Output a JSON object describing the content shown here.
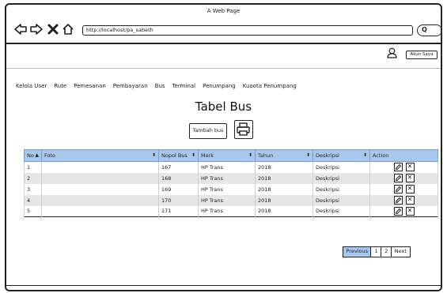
{
  "window": {
    "title": "A Web Page"
  },
  "browser": {
    "url": "http://localhost/pa_sabeth",
    "search_glyph": "Q"
  },
  "header": {
    "account_button": "Akun Saya"
  },
  "menu": [
    "Kelola User",
    "Rute",
    "Pemesanan",
    "Pembayaran",
    "Bus",
    "Terminal",
    "Penumpang",
    "Kuoota Penumpang"
  ],
  "main": {
    "title": "Tabel Bus",
    "add_button": "Tambah bus"
  },
  "table": {
    "columns": [
      "No",
      "Foto",
      "Nopol Bus",
      "Merk",
      "Tahun",
      "Deskripsi",
      "Action"
    ],
    "rows": [
      [
        "1",
        "",
        "167",
        "HP Trans",
        "2018",
        "Deskripsi"
      ],
      [
        "2",
        "",
        "168",
        "HP Trans",
        "2018",
        "Deskripsi"
      ],
      [
        "3",
        "",
        "169",
        "HP Trans",
        "2018",
        "Deskripsi"
      ],
      [
        "4",
        "",
        "170",
        "HP Trans",
        "2018",
        "Deskripsi"
      ],
      [
        "5",
        "",
        "171",
        "HP Trans",
        "2018",
        "Deskripsi"
      ]
    ]
  },
  "pagination": {
    "previous": "Previous",
    "pages": [
      "1",
      "2"
    ],
    "next": "Next"
  },
  "colors": {
    "header_fill": "#a9c7ee",
    "stripe": "#e6e6e6"
  },
  "icons": [
    "back-icon",
    "forward-icon",
    "close-icon",
    "home-icon",
    "user-icon",
    "printer-icon",
    "edit-icon",
    "delete-icon",
    "sort-icon"
  ]
}
